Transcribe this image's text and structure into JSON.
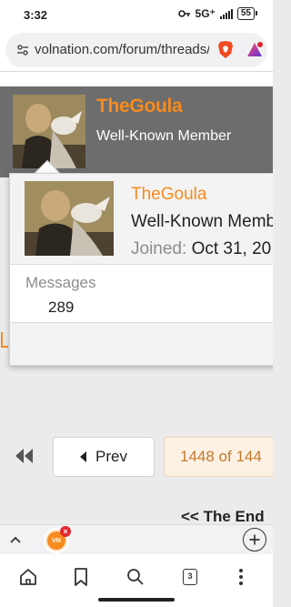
{
  "status_bar": {
    "time": "3:32",
    "network": "5G⁺",
    "battery": "55"
  },
  "browser": {
    "url": "volnation.com/forum/threads/ra"
  },
  "profile_header": {
    "username": "TheGoula",
    "member_title": "Well-Known Member"
  },
  "member_card": {
    "username": "TheGoula",
    "member_title": "Well-Known Member",
    "joined_label": "Joined:",
    "joined_value": "Oct 31, 20",
    "messages_label": "Messages",
    "messages_value": "289"
  },
  "pagination": {
    "prev_label": "Prev",
    "page_indicator": "1448 of 144"
  },
  "end_text": "<< The End",
  "toolbar": {
    "tab_favicon_text": "VN",
    "tab_count": "3"
  },
  "colors": {
    "brand_orange": "#f68b1f",
    "header_gray": "#6d6d6d",
    "page_bg": "#ebebeb"
  }
}
